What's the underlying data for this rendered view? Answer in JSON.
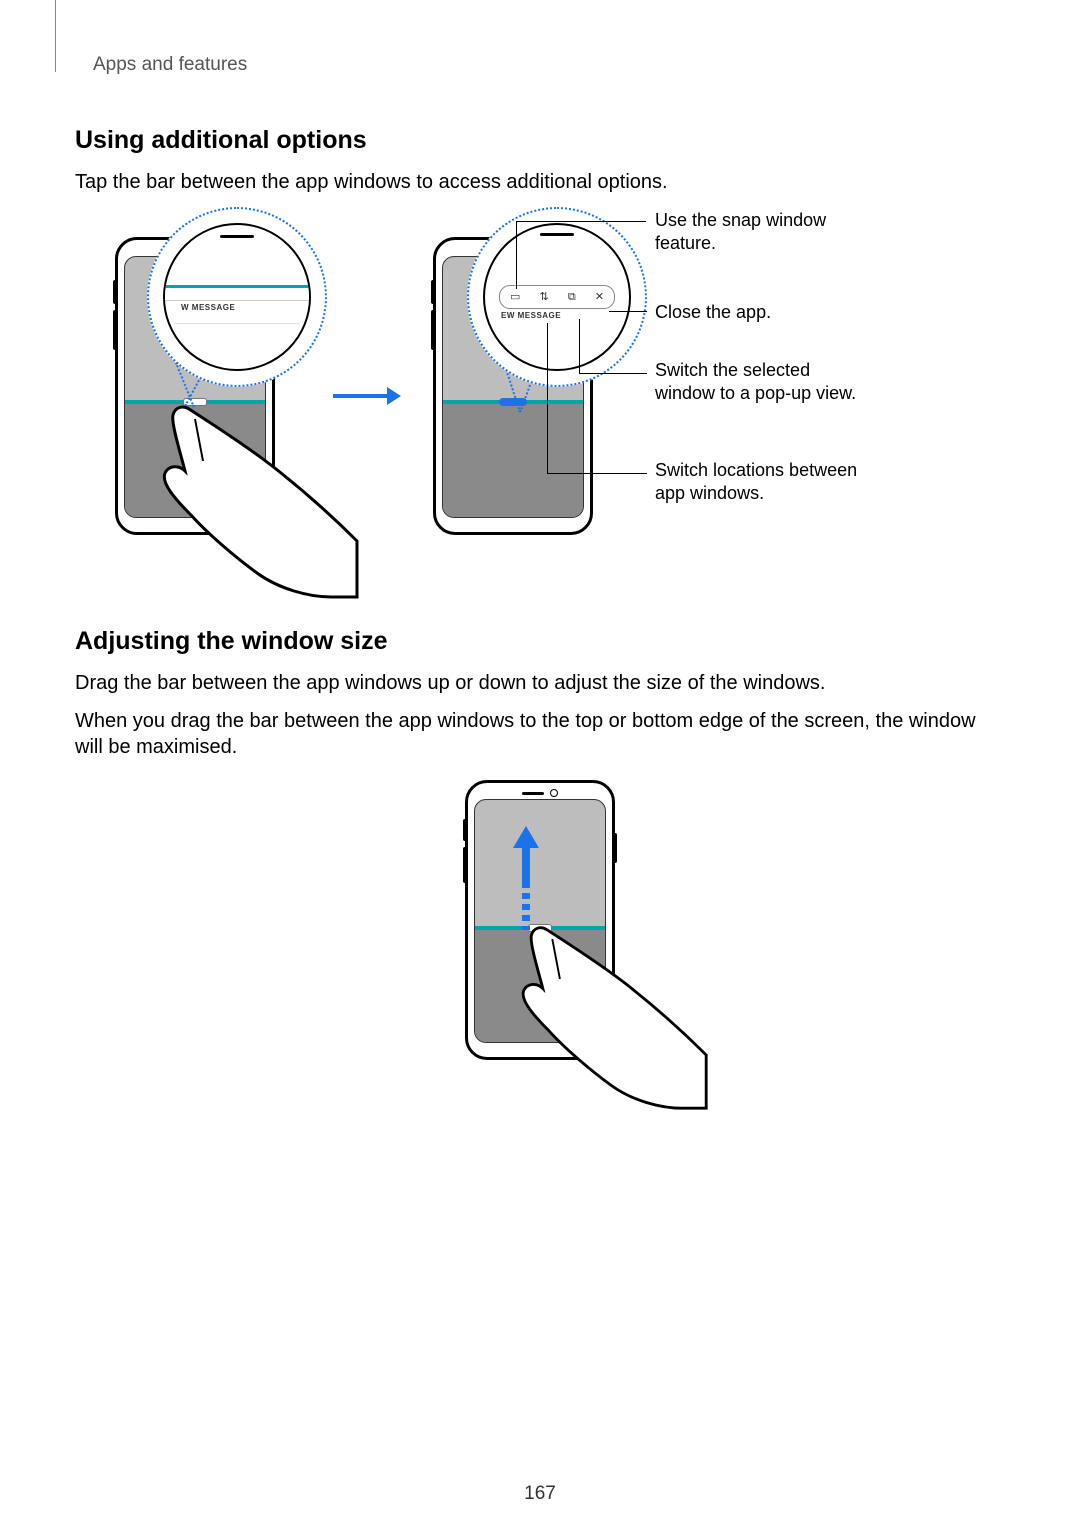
{
  "breadcrumb": "Apps and features",
  "section1": {
    "heading": "Using additional options",
    "body": "Tap the bar between the app windows to access additional options."
  },
  "callouts": {
    "snap": "Use the snap window feature.",
    "close": "Close the app.",
    "popup": "Switch the selected window to a pop-up view.",
    "swap": "Switch locations between app windows."
  },
  "msg_label_left": "W MESSAGE",
  "msg_label_right": "EW MESSAGE",
  "section2": {
    "heading": "Adjusting the window size",
    "body1": "Drag the bar between the app windows up or down to adjust the size of the windows.",
    "body2": "When you drag the bar between the app windows to the top or bottom edge of the screen, the window will be maximised."
  },
  "page_number": "167"
}
